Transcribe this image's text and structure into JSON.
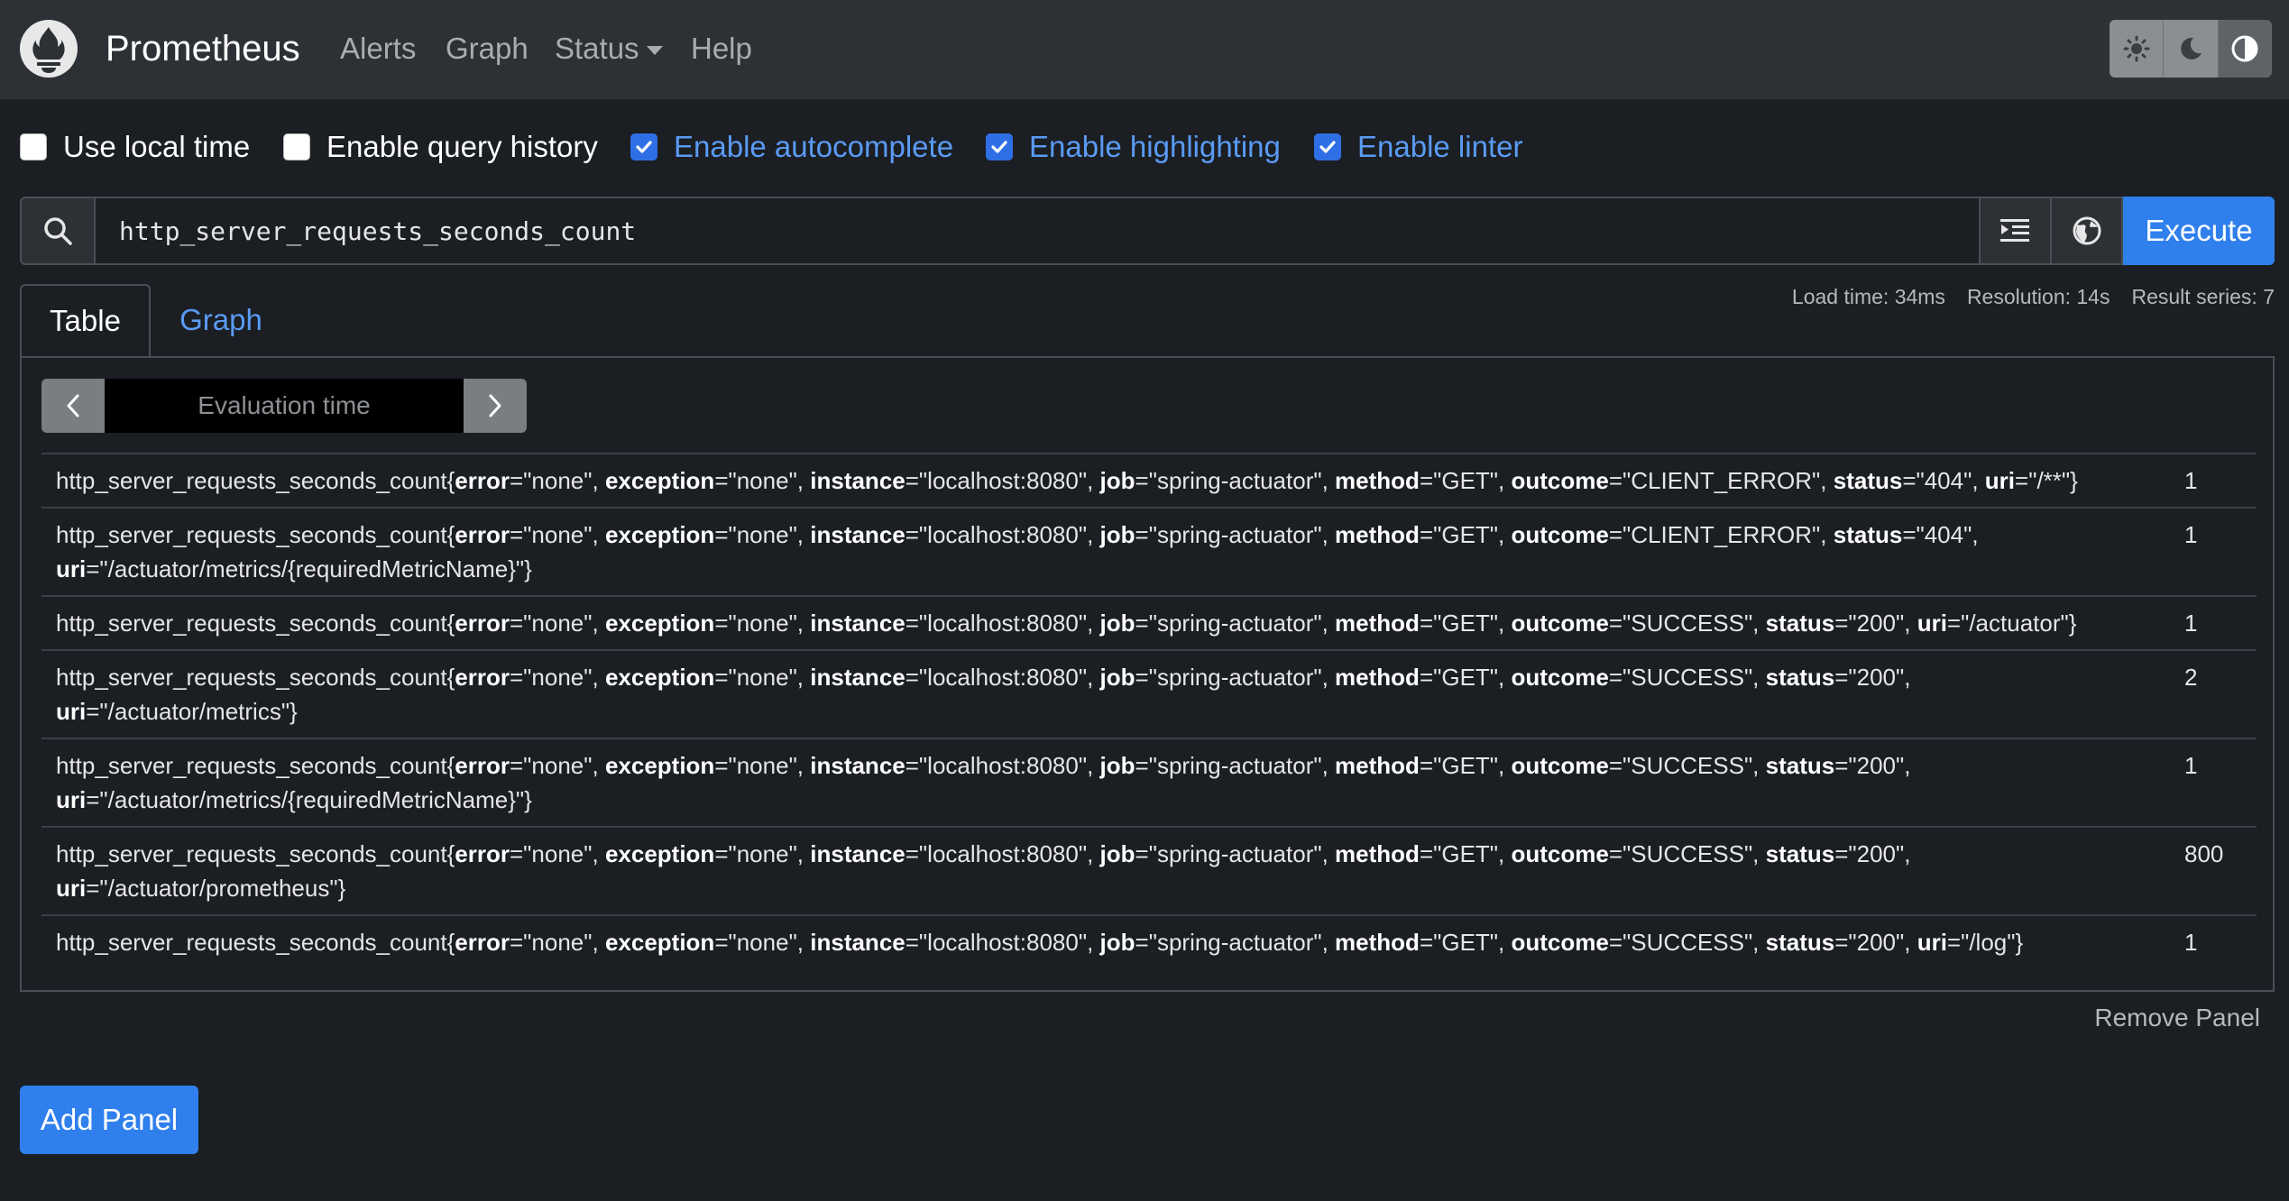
{
  "nav": {
    "brand": "Prometheus",
    "items": [
      "Alerts",
      "Graph",
      "Status",
      "Help"
    ],
    "theme_buttons": [
      "light-icon",
      "dark-icon",
      "auto-icon"
    ]
  },
  "options": [
    {
      "label": "Use local time",
      "checked": false
    },
    {
      "label": "Enable query history",
      "checked": false
    },
    {
      "label": "Enable autocomplete",
      "checked": true
    },
    {
      "label": "Enable highlighting",
      "checked": true
    },
    {
      "label": "Enable linter",
      "checked": true
    }
  ],
  "query": {
    "value": "http_server_requests_seconds_count",
    "execute_label": "Execute"
  },
  "stats": {
    "load_time": "Load time: 34ms",
    "resolution": "Resolution: 14s",
    "result_series": "Result series: 7"
  },
  "tabs": {
    "table": "Table",
    "graph": "Graph"
  },
  "eval": {
    "placeholder": "Evaluation time"
  },
  "metric": "http_server_requests_seconds_count",
  "rows": [
    {
      "labels": [
        [
          "error",
          "none"
        ],
        [
          "exception",
          "none"
        ],
        [
          "instance",
          "localhost:8080"
        ],
        [
          "job",
          "spring-actuator"
        ],
        [
          "method",
          "GET"
        ],
        [
          "outcome",
          "CLIENT_ERROR"
        ],
        [
          "status",
          "404"
        ],
        [
          "uri",
          "/**"
        ]
      ],
      "value": "1"
    },
    {
      "labels": [
        [
          "error",
          "none"
        ],
        [
          "exception",
          "none"
        ],
        [
          "instance",
          "localhost:8080"
        ],
        [
          "job",
          "spring-actuator"
        ],
        [
          "method",
          "GET"
        ],
        [
          "outcome",
          "CLIENT_ERROR"
        ],
        [
          "status",
          "404"
        ],
        [
          "uri",
          "/actuator/metrics/{requiredMetricName}"
        ]
      ],
      "value": "1"
    },
    {
      "labels": [
        [
          "error",
          "none"
        ],
        [
          "exception",
          "none"
        ],
        [
          "instance",
          "localhost:8080"
        ],
        [
          "job",
          "spring-actuator"
        ],
        [
          "method",
          "GET"
        ],
        [
          "outcome",
          "SUCCESS"
        ],
        [
          "status",
          "200"
        ],
        [
          "uri",
          "/actuator"
        ]
      ],
      "value": "1"
    },
    {
      "labels": [
        [
          "error",
          "none"
        ],
        [
          "exception",
          "none"
        ],
        [
          "instance",
          "localhost:8080"
        ],
        [
          "job",
          "spring-actuator"
        ],
        [
          "method",
          "GET"
        ],
        [
          "outcome",
          "SUCCESS"
        ],
        [
          "status",
          "200"
        ],
        [
          "uri",
          "/actuator/metrics"
        ]
      ],
      "value": "2"
    },
    {
      "labels": [
        [
          "error",
          "none"
        ],
        [
          "exception",
          "none"
        ],
        [
          "instance",
          "localhost:8080"
        ],
        [
          "job",
          "spring-actuator"
        ],
        [
          "method",
          "GET"
        ],
        [
          "outcome",
          "SUCCESS"
        ],
        [
          "status",
          "200"
        ],
        [
          "uri",
          "/actuator/metrics/{requiredMetricName}"
        ]
      ],
      "value": "1"
    },
    {
      "labels": [
        [
          "error",
          "none"
        ],
        [
          "exception",
          "none"
        ],
        [
          "instance",
          "localhost:8080"
        ],
        [
          "job",
          "spring-actuator"
        ],
        [
          "method",
          "GET"
        ],
        [
          "outcome",
          "SUCCESS"
        ],
        [
          "status",
          "200"
        ],
        [
          "uri",
          "/actuator/prometheus"
        ]
      ],
      "value": "800"
    },
    {
      "labels": [
        [
          "error",
          "none"
        ],
        [
          "exception",
          "none"
        ],
        [
          "instance",
          "localhost:8080"
        ],
        [
          "job",
          "spring-actuator"
        ],
        [
          "method",
          "GET"
        ],
        [
          "outcome",
          "SUCCESS"
        ],
        [
          "status",
          "200"
        ],
        [
          "uri",
          "/log"
        ]
      ],
      "value": "1"
    }
  ],
  "remove_panel": "Remove Panel",
  "add_panel": "Add Panel",
  "colors": {
    "accent": "#2f80ed",
    "link": "#5a9bf4",
    "navbar": "#2d3136",
    "background": "#1b1e23"
  }
}
